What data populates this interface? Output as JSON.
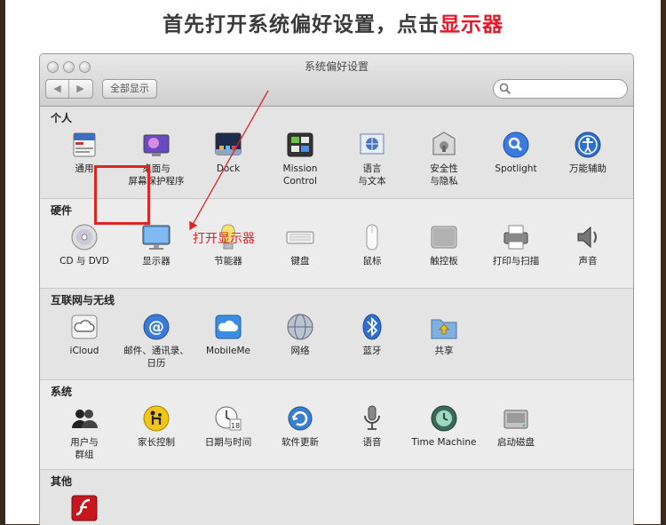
{
  "banner": {
    "prefix": "首先打开系统偏好设置，点击",
    "highlight": "显示器"
  },
  "window": {
    "title": "系统偏好设置",
    "show_all": "全部显示",
    "nav_back": "◀",
    "nav_forward": "▶"
  },
  "sections": [
    {
      "title": "个人",
      "items": [
        {
          "label": "通用",
          "icon": "general-icon"
        },
        {
          "label": "桌面与\n屏幕保护程序",
          "icon": "desktop-icon"
        },
        {
          "label": "Dock",
          "icon": "dock-icon"
        },
        {
          "label": "Mission\nControl",
          "icon": "mission-control-icon"
        },
        {
          "label": "语言\n与文本",
          "icon": "language-icon"
        },
        {
          "label": "安全性\n与隐私",
          "icon": "security-icon"
        },
        {
          "label": "Spotlight",
          "icon": "spotlight-icon"
        },
        {
          "label": "万能辅助",
          "icon": "accessibility-icon"
        }
      ]
    },
    {
      "title": "硬件",
      "items": [
        {
          "label": "CD 与 DVD",
          "icon": "cd-icon"
        },
        {
          "label": "显示器",
          "icon": "display-icon"
        },
        {
          "label": "节能器",
          "icon": "energy-saver-icon"
        },
        {
          "label": "键盘",
          "icon": "keyboard-icon"
        },
        {
          "label": "鼠标",
          "icon": "mouse-icon"
        },
        {
          "label": "触控板",
          "icon": "trackpad-icon"
        },
        {
          "label": "打印与扫描",
          "icon": "printer-icon"
        },
        {
          "label": "声音",
          "icon": "sound-icon"
        }
      ]
    },
    {
      "title": "互联网与无线",
      "items": [
        {
          "label": "iCloud",
          "icon": "icloud-icon"
        },
        {
          "label": "邮件、通讯录、\n日历",
          "icon": "mail-icon"
        },
        {
          "label": "MobileMe",
          "icon": "mobileme-icon"
        },
        {
          "label": "网络",
          "icon": "network-icon"
        },
        {
          "label": "蓝牙",
          "icon": "bluetooth-icon"
        },
        {
          "label": "共享",
          "icon": "sharing-icon"
        }
      ]
    },
    {
      "title": "系统",
      "items": [
        {
          "label": "用户与\n群组",
          "icon": "users-icon"
        },
        {
          "label": "家长控制",
          "icon": "parental-controls-icon"
        },
        {
          "label": "日期与时间",
          "icon": "date-time-icon"
        },
        {
          "label": "软件更新",
          "icon": "software-update-icon"
        },
        {
          "label": "语音",
          "icon": "speech-icon"
        },
        {
          "label": "Time Machine",
          "icon": "time-machine-icon"
        },
        {
          "label": "启动磁盘",
          "icon": "startup-disk-icon"
        }
      ]
    },
    {
      "title": "其他",
      "items": [
        {
          "label": "",
          "icon": "flash-icon"
        }
      ]
    }
  ],
  "annotation": {
    "text": "打开显示器"
  },
  "colors": {
    "highlight": "#e8182b",
    "annotation": "#e02424"
  }
}
